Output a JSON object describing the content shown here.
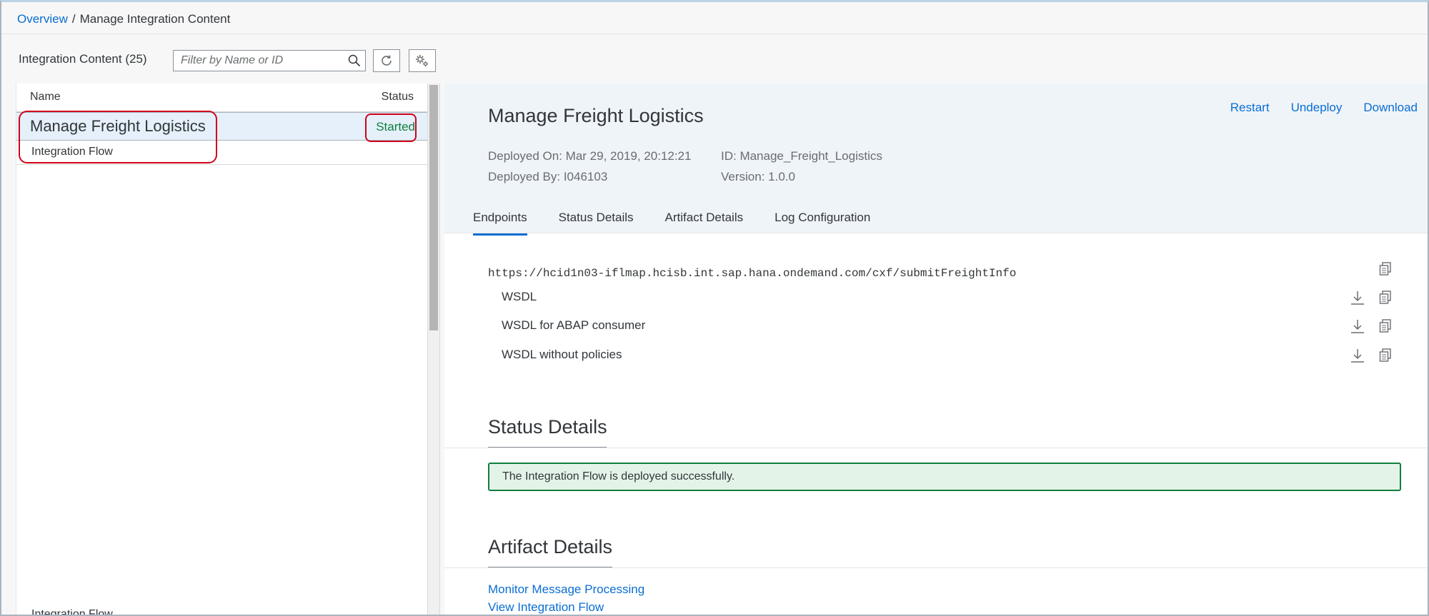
{
  "breadcrumb": {
    "root": "Overview",
    "separator": "/",
    "current": "Manage Integration Content"
  },
  "toolbar": {
    "title": "Integration Content (25)",
    "search_placeholder": "Filter by Name or ID"
  },
  "list": {
    "columns": {
      "name": "Name",
      "status": "Status"
    },
    "items": [
      {
        "title": "Manage Freight Logistics",
        "type": "Integration Flow",
        "status": "Started"
      }
    ],
    "partial_item_type": "Integration Flow"
  },
  "detail": {
    "title": "Manage Freight Logistics",
    "actions": [
      "Restart",
      "Undeploy",
      "Download"
    ],
    "deployed_on": "Deployed On: Mar 29, 2019, 20:12:21",
    "deployed_by": "Deployed By: I046103",
    "id": "ID: Manage_Freight_Logistics",
    "version": "Version: 1.0.0",
    "tabs": [
      "Endpoints",
      "Status Details",
      "Artifact Details",
      "Log Configuration"
    ],
    "active_tab": "Endpoints",
    "endpoint_url": "https://hcid1n03-iflmap.hcisb.int.sap.hana.ondemand.com/cxf/submitFreightInfo",
    "wsdl_links": [
      "WSDL",
      "WSDL for ABAP consumer",
      "WSDL without policies"
    ],
    "status_section_title": "Status Details",
    "status_message": "The Integration Flow is deployed successfully.",
    "artifact_section_title": "Artifact Details",
    "artifact_links": [
      "Monitor Message Processing",
      "View Integration Flow"
    ]
  },
  "colors": {
    "accent": "#0a6ed1",
    "success": "#107e3e",
    "highlight_annotation": "#d0021b"
  }
}
